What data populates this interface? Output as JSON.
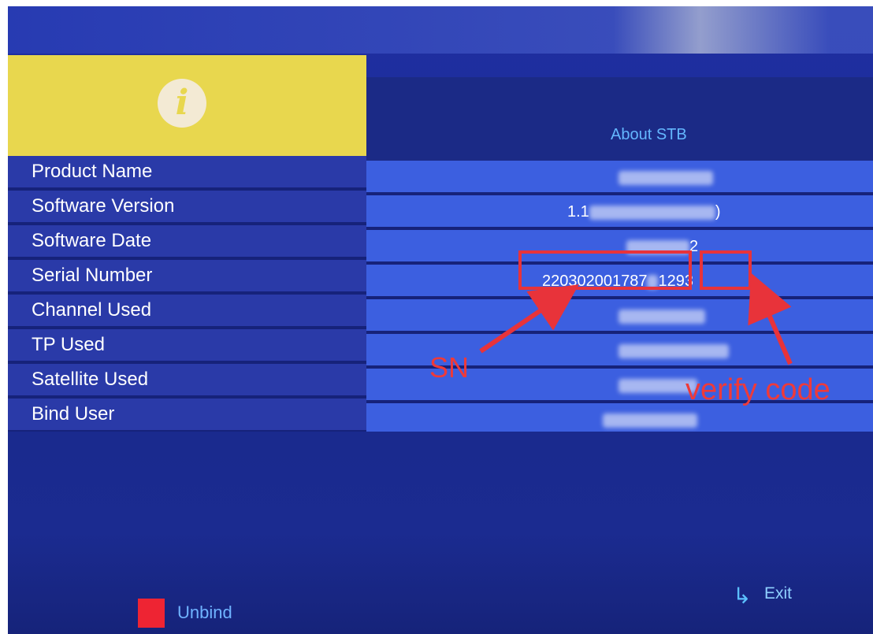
{
  "screen": {
    "title": "About STB",
    "info_icon": "info-icon",
    "rows": [
      {
        "label": "Product Name",
        "value_prefix": "",
        "value": "",
        "blurred": true
      },
      {
        "label": "Software Version",
        "value_prefix": "1.1",
        "value": ")",
        "blurred": true
      },
      {
        "label": "Software Date",
        "value_prefix": "",
        "value": "2",
        "blurred": true
      },
      {
        "label": "Serial Number",
        "value_prefix": "220302001787",
        "value": "1293",
        "blurred": true
      },
      {
        "label": "Channel Used",
        "value_prefix": "",
        "value": "",
        "blurred": true
      },
      {
        "label": "TP Used",
        "value_prefix": "",
        "value": "",
        "blurred": true
      },
      {
        "label": "Satellite Used",
        "value_prefix": "",
        "value": "",
        "blurred": true
      },
      {
        "label": "Bind User",
        "value_prefix": "",
        "value": "",
        "blurred": true
      }
    ],
    "footer": {
      "unbind_label": "Unbind",
      "exit_label": "Exit",
      "unbind_key_color": "#ee2433",
      "exit_icon": "return-arrow-icon"
    }
  },
  "annotations": {
    "sn_label": "SN",
    "verify_label": "verify code",
    "color": "#e8333a"
  }
}
